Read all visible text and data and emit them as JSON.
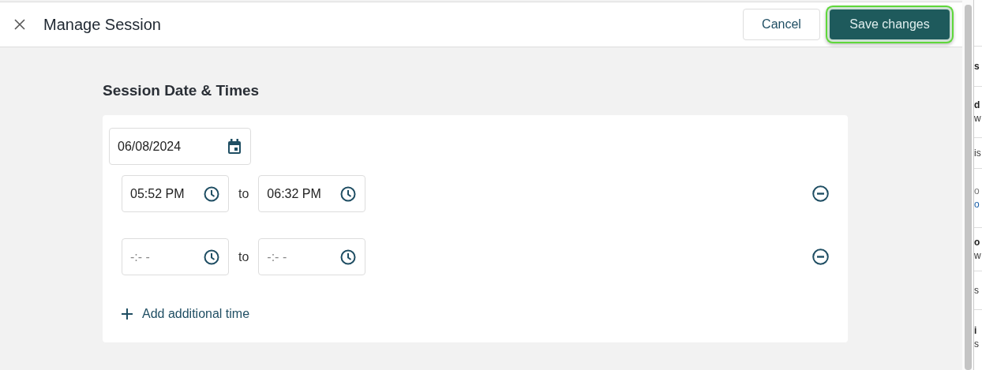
{
  "header": {
    "title": "Manage Session",
    "buttons": [
      {
        "label": "Cancel",
        "kind": "secondary",
        "focused": false
      },
      {
        "label": "Save changes",
        "kind": "primary",
        "focused": true
      }
    ]
  },
  "section": {
    "heading": "Session Date & Times",
    "date": {
      "value": "06/08/2024"
    },
    "times": [
      {
        "start": {
          "value": "05:52 PM"
        },
        "separator": "to",
        "end": {
          "value": "06:32 PM"
        }
      },
      {
        "start": {
          "placeholder": "-:- -"
        },
        "separator": "to",
        "end": {
          "placeholder": "-:- -"
        }
      }
    ],
    "add_link": "Add additional time"
  },
  "background_panel": {
    "groups": [
      {
        "items": [
          {
            "text": "s",
            "kind": "bold"
          }
        ]
      },
      {
        "items": [
          {
            "text": "d",
            "kind": "bold"
          },
          {
            "text": "w",
            "kind": "plain"
          }
        ]
      },
      {
        "items": [
          {
            "text": "is",
            "kind": "plain"
          }
        ]
      },
      {
        "items": [
          {
            "text": "o",
            "kind": "muted"
          },
          {
            "text": "o",
            "kind": "link"
          }
        ]
      },
      {
        "items": [
          {
            "text": "o",
            "kind": "bold"
          },
          {
            "text": "w",
            "kind": "plain"
          }
        ]
      },
      {
        "items": [
          {
            "text": "s",
            "kind": "plain"
          }
        ]
      },
      {
        "items": [
          {
            "text": "i",
            "kind": "bold"
          },
          {
            "text": "s",
            "kind": "plain"
          }
        ]
      }
    ]
  }
}
